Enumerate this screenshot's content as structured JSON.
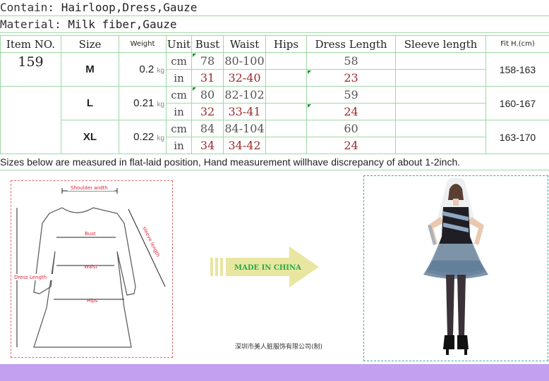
{
  "header": {
    "contain_label": "Contain:",
    "contain_value": "Hairloop,Dress,Gauze",
    "material_label": "Material:",
    "material_value": "Milk fiber,Gauze"
  },
  "table": {
    "columns": [
      "Item NO.",
      "Size",
      "Weight",
      "Unit",
      "Bust",
      "Waist",
      "Hips",
      "Dress Length",
      "Sleeve length",
      "Fit H.(cm)"
    ],
    "item_no": "159",
    "weight_unit": "kg",
    "unit_cm": "cm",
    "unit_in": "in",
    "rows": [
      {
        "size": "M",
        "weight": "0.2",
        "bust_cm": "78",
        "bust_in": "31",
        "waist_cm": "80-100",
        "waist_in": "32-40",
        "hips_cm": "",
        "hips_in": "",
        "length_cm": "58",
        "length_in": "23",
        "sleeve_cm": "",
        "sleeve_in": "",
        "fit": "158-163"
      },
      {
        "size": "L",
        "weight": "0.21",
        "bust_cm": "80",
        "bust_in": "32",
        "waist_cm": "82-102",
        "waist_in": "33-41",
        "hips_cm": "",
        "hips_in": "",
        "length_cm": "59",
        "length_in": "24",
        "sleeve_cm": "",
        "sleeve_in": "",
        "fit": "160-167"
      },
      {
        "size": "XL",
        "weight": "0.22",
        "bust_cm": "84",
        "bust_in": "34",
        "waist_cm": "84-104",
        "waist_in": "34-42",
        "hips_cm": "",
        "hips_in": "",
        "length_cm": "60",
        "length_in": "24",
        "sleeve_cm": "",
        "sleeve_in": "",
        "fit": "163-170"
      }
    ]
  },
  "note": "Sizes below are measured in flat-laid position, Hand measurement willhave discrepancy of about 1-2inch.",
  "diagram": {
    "shoulder": "Shoulder width",
    "bust": "Bust",
    "waist": "Waist",
    "hips": "Hips",
    "dress_length": "Dress Length",
    "sleeve_length": "sleeve length"
  },
  "arrow_text": "MADE IN CHINA",
  "factory": "深圳市美人脏服饰有限公司(制)",
  "colors": {
    "grid": "#9fd7a5",
    "inch_text": "#9b2b2b",
    "arrow": "#e8e6a0",
    "arrow_text": "#2aa84a",
    "bottom_bar": "#c3a0f0",
    "diagram_border": "#e06a6a",
    "photo_border": "#3aa9a0"
  }
}
